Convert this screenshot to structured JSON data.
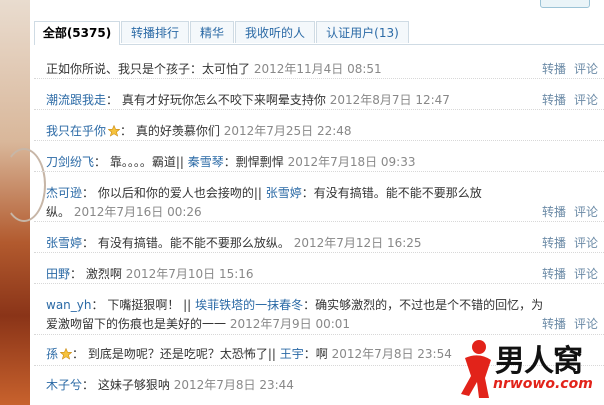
{
  "tabs": [
    {
      "label": "全部(5375)"
    },
    {
      "label": "转播排行"
    },
    {
      "label": "精华"
    },
    {
      "label": "我收听的人"
    },
    {
      "label": "认证用户(13)"
    }
  ],
  "actions": {
    "repost": "转播",
    "comment": "评论"
  },
  "rows": [
    {
      "user": "",
      "sep": "",
      "mentions": [],
      "text": "正如你所说、我只是个孩子：太可怕了",
      "date": "2012年11月4日 08:51"
    },
    {
      "user": "潮流跟我走",
      "sep": "：",
      "text": "真有才好玩你怎么不咬下来啊晕支持你",
      "date": "2012年8月7日 12:47"
    },
    {
      "user": "我只在乎你",
      "sep": "：",
      "text": "真的好羡慕你们",
      "date": "2012年7月25日 22:48"
    },
    {
      "user": "刀剑纷飞",
      "sep": "：",
      "text": "靠。。。。霸道||",
      "mention": "秦雪琴",
      "mention_text": "：剽悍剽悍",
      "date": "2012年7月18日 09:33"
    },
    {
      "user": "杰可逊",
      "sep": "：",
      "text": "你以后和你的爱人也会接吻的||",
      "mention": "张雪婷",
      "mention_text": "：有没有搞错。能不能不要那么放",
      "text2": "纵。",
      "date": "2012年7月16日 00:26"
    },
    {
      "user": "张雪婷",
      "sep": "：",
      "text": "有没有搞错。能不能不要那么放纵。",
      "date": "2012年7月12日 16:25"
    },
    {
      "user": "田野",
      "sep": "：",
      "text": "激烈啊",
      "date": "2012年7月10日 15:16"
    },
    {
      "user": "wan_yh",
      "sep": "：",
      "text": "下嘴挺狠啊！ ||",
      "mention": "埃菲铁塔的一抹春冬",
      "mention_text": "：确实够激烈的，不过也是个不错的回忆，为",
      "text2": "爱激吻留下的伤痕也是美好的一一",
      "date": "2012年7月9日 00:01"
    },
    {
      "user": "孫",
      "sep": "：",
      "text": "到底是吻呢？还是吃呢？太恐怖了||",
      "mention": "王宇",
      "mention_text": "：啊",
      "date": "2012年7月8日 23:54"
    },
    {
      "user": "木子兮",
      "sep": "：",
      "text": "这妹子够狠呐",
      "date": "2012年7月8日 23:44"
    }
  ],
  "watermark": {
    "text": "男人窝",
    "url": "nrwowo.com"
  },
  "colors": {
    "link": "#2b6aa6",
    "date": "#888888",
    "action": "#6b8aa6",
    "tab_border": "#cfdbe4"
  }
}
